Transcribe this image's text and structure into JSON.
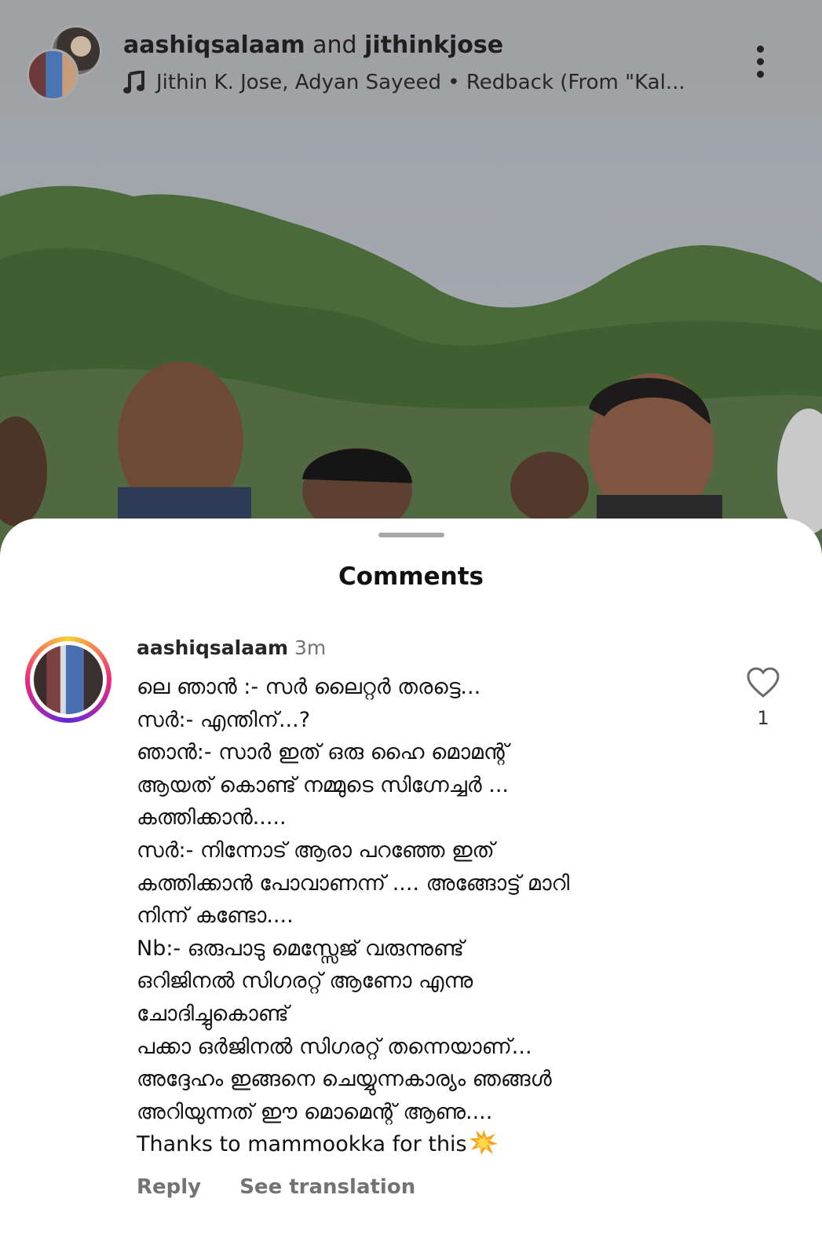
{
  "post_header": {
    "user1": "aashiqsalaam",
    "joiner": "and",
    "user2": "jithinkjose",
    "audio_icon": "music-note-icon",
    "audio_text": "Jithin K. Jose, Adyan Sayeed • Redback (From \"Kal...",
    "menu_icon": "more-vertical-icon"
  },
  "sheet": {
    "title": "Comments"
  },
  "comment": {
    "username": "aashiqsalaam",
    "time": "3m",
    "lines": [
      "ലെ ഞാൻ :- സർ ലൈറ്റർ തരട്ടെ...",
      "സർ:- എന്തിന്...?",
      "ഞാൻ:- സാർ ഇത് ഒരു ഹൈ മൊമന്റ്",
      "ആയത് കൊണ്ട് നമ്മുടെ സിഗ്നേച്ചർ ...",
      "കത്തിക്കാൻ.....",
      "സർ:- നിന്നോട് ആരാ പറഞ്ഞേ ഇത്",
      "കത്തിക്കാൻ പോവാണന്ന് .... അങ്ങോട്ട് മാറി",
      "നിന്ന് കണ്ടോ....",
      "Nb:- ഒരുപാടു മെസ്സേജ് വരുന്നുണ്ട്",
      "ഒറിജിനൽ സിഗരറ്റ് ആണോ എന്നു",
      "ചോദിച്ചുകൊണ്ട്",
      "പക്കാ ഒർജിനൽ സിഗരറ്റ് തന്നെയാണ്...",
      "അദ്ദേഹം ഇങ്ങനെ ചെയ്യുന്നകാര്യം ഞങ്ങൾ",
      "അറിയുന്നത് ഈ മൊമെന്റ് ആണു....",
      "Thanks to mammookka for this"
    ],
    "emoji": "collision-icon",
    "like_icon": "heart-outline-icon",
    "like_count": "1",
    "reply_label": "Reply",
    "translate_label": "See translation"
  }
}
